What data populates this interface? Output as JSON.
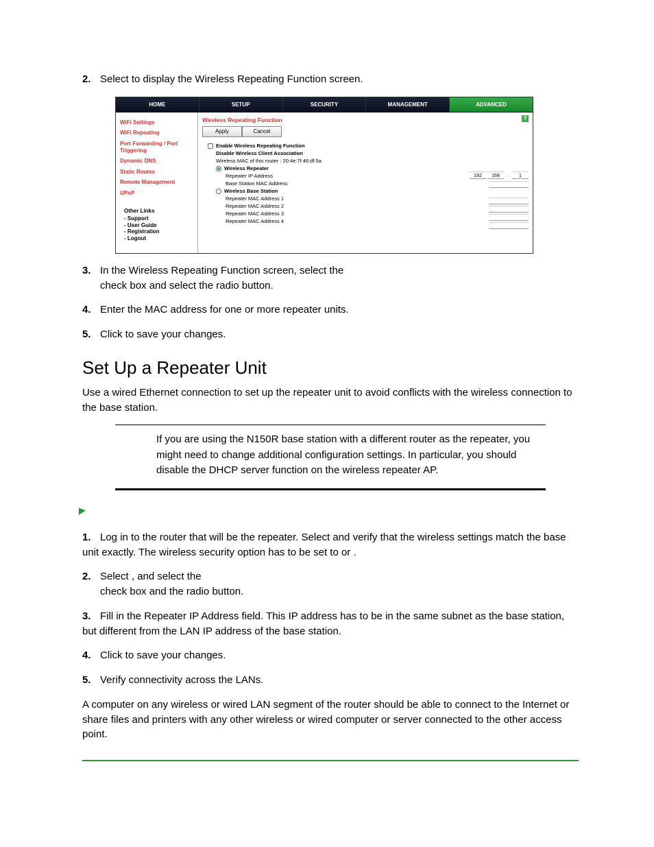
{
  "steps_a": {
    "s2": {
      "num": "2.",
      "pre": "Select ",
      "post": " to display the Wireless Repeating Function screen."
    },
    "s3": {
      "num": "3.",
      "l1": "In the Wireless Repeating Function screen, select the ",
      "l2": " check box and select the ",
      "l3": " radio button."
    },
    "s4": {
      "num": "4.",
      "text": "Enter the MAC address for one or more repeater units."
    },
    "s5": {
      "num": "5.",
      "pre": "Click ",
      "post": " to save your changes."
    }
  },
  "section": {
    "title": "Set Up a Repeater Unit"
  },
  "para1": "Use a wired Ethernet connection to set up the repeater unit to avoid conflicts with the wireless connection to the base station.",
  "note": "If you are using the N150R base station with a different router as the repeater, you might need to change additional configuration settings. In particular, you should disable the DHCP server function on the wireless repeater AP.",
  "steps_b": {
    "s1": {
      "num": "1.",
      "a": "Log in to the router that will be the repeater. Select ",
      "b": " and verify that the wireless settings match the base unit exactly. The wireless security option has to be set to ",
      "c": " or "
    },
    "s2": {
      "num": "2.",
      "a": "Select ",
      "b": ", and select the ",
      "c": " check box and the ",
      "d": " radio button."
    },
    "s3": {
      "num": "3.",
      "text": "Fill in the Repeater IP Address field. This IP address has to be in the same subnet as the base station, but different from the LAN IP address of the base station."
    },
    "s4": {
      "num": "4.",
      "pre": "Click ",
      "post": " to save your changes."
    },
    "s5": {
      "num": "5.",
      "text": "Verify connectivity across the LANs."
    },
    "tail": "A computer on any wireless or wired LAN segment of the router should be able to connect to the Internet or share files and printers with any other wireless or wired computer or server connected to the other access point."
  },
  "shot": {
    "tabs": [
      "HOME",
      "SETUP",
      "SECURITY",
      "MANAGEMENT",
      "ADVANCED"
    ],
    "side": [
      "WiFi Settings",
      "WiFi Repeating",
      "Port Forwarding / Port Triggering",
      "Dynamic DNS",
      "Static Routes",
      "Remote Management",
      "UPnP"
    ],
    "other_hdr": "Other Links",
    "other": [
      "- Support",
      "- User Guide",
      "- Registration",
      "- Logout"
    ],
    "title": "Wireless Repeating Function",
    "apply": "Apply",
    "cancel": "Cancel",
    "chk1": "Enable Wireless Repeating Function",
    "chk2": "Disable Wireless Client Association",
    "mac_line": "Wireless MAC of this router : 20:4e:7f:46:df:5a",
    "opt1": "Wireless Repeater",
    "sub1": "Repeater IP Address",
    "sub2": "Base Station MAC Address",
    "opt2": "Wireless Base Station",
    "sub3": "Repeater MAC Address 1",
    "sub4": "Repeater MAC Address 2",
    "sub5": "Repeater MAC Address 3",
    "sub6": "Repeater MAC Address 4",
    "ip": [
      "192",
      "168",
      ".",
      "1"
    ]
  }
}
